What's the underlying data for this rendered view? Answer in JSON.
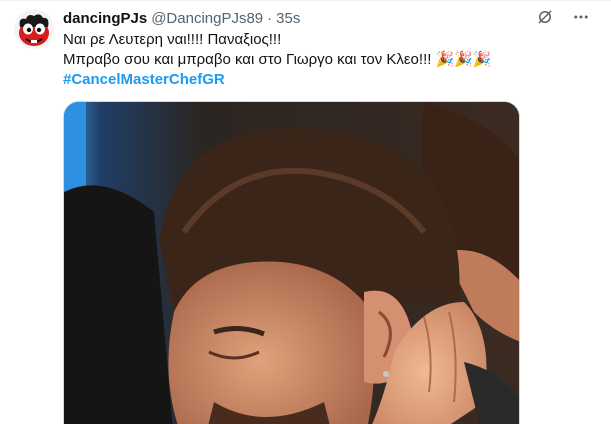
{
  "tweet": {
    "display_name": "dancingPJs",
    "handle": "@DancingPJs89",
    "separator": "·",
    "time": "35s",
    "lines": [
      "Ναι ρε Λευτερη ναι!!!! Παναξιος!!!",
      "Μπραβο σου και μπραβο και στο Γιωργο και τον Κλεο!!! 🎉🎉🎉"
    ],
    "hashtag": "#CancelMasterChefGR"
  },
  "icons": {
    "avatar": "red-cartoon-avatar",
    "grok": "grok-icon",
    "more": "more-icon",
    "party": "party-popper-icon"
  },
  "colors": {
    "link": "#1d9bf0",
    "secondary_text": "#536471",
    "primary_text": "#0f1419"
  }
}
